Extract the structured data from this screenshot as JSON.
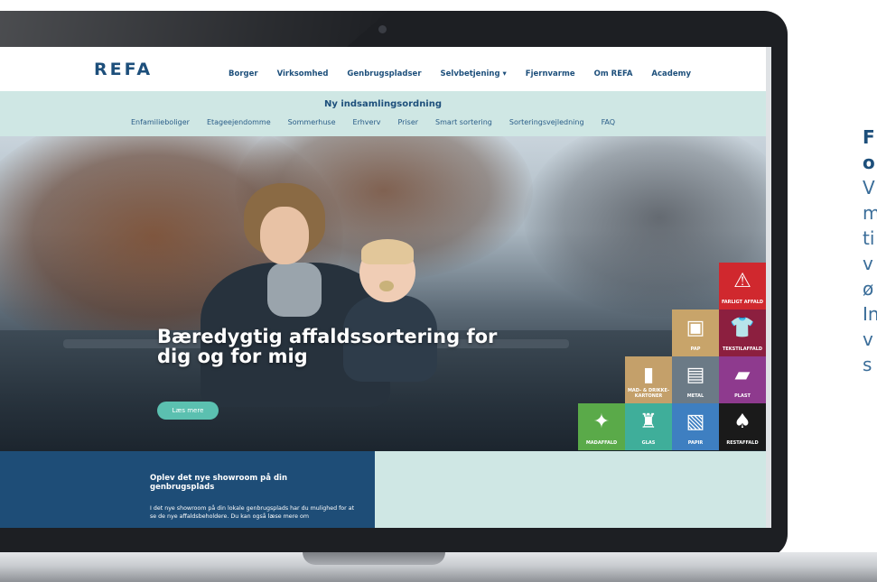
{
  "site": {
    "logo": "REFA",
    "main_menu": [
      "Borger",
      "Virksomhed",
      "Genbrugspladser",
      "Selvbetjening ▾",
      "Fjernvarme",
      "Om REFA",
      "Academy"
    ]
  },
  "subnav": {
    "title": "Ny indsamlingsordning",
    "items": [
      "Enfamilieboliger",
      "Etageejendomme",
      "Sommerhuse",
      "Erhverv",
      "Priser",
      "Smart sortering",
      "Sorteringsvejledning",
      "FAQ"
    ]
  },
  "hero": {
    "title": "Bæredygtig affaldssortering for dig og for mig",
    "button": "Læs mere"
  },
  "tiles": [
    {
      "label": "FARLIGT AFFALD",
      "icon": "⚠",
      "color": "#d0282e",
      "icon_name": "hazard-icon"
    },
    {
      "label": "PAP",
      "icon": "▣",
      "color": "#c8a46a",
      "icon_name": "box-icon"
    },
    {
      "label": "TEKSTILAFFALD",
      "icon": "👕",
      "color": "#8c1f3f",
      "icon_name": "shirt-icon"
    },
    {
      "label": "MAD- & DRIKKE-KARTONER",
      "icon": "▮",
      "color": "#c4a06a",
      "icon_name": "carton-icon"
    },
    {
      "label": "METAL",
      "icon": "▤",
      "color": "#6b7a86",
      "icon_name": "can-icon"
    },
    {
      "label": "PLAST",
      "icon": "▰",
      "color": "#8e3a8e",
      "icon_name": "plastic-bottle-icon"
    },
    {
      "label": "MADAFFALD",
      "icon": "✦",
      "color": "#5aaa49",
      "icon_name": "apple-core-icon"
    },
    {
      "label": "GLAS",
      "icon": "♜",
      "color": "#3fae9a",
      "icon_name": "glass-bottle-icon"
    },
    {
      "label": "PAPIR",
      "icon": "▧",
      "color": "#3e7fc1",
      "icon_name": "paper-icon"
    },
    {
      "label": "RESTAFFALD",
      "icon": "♠",
      "color": "#1a1a1a",
      "icon_name": "trash-bag-icon"
    }
  ],
  "promo": {
    "title": "Oplev det nye showroom på din genbrugsplads",
    "text": "I det nye showroom på din lokale genbrugsplads har du mulighed for at se de nye affaldsbeholdere. Du kan også læse mere om"
  },
  "side_text": {
    "heading": [
      "F",
      "o"
    ],
    "body": [
      "V",
      "m",
      "ti",
      "v",
      "ø",
      "In",
      "v",
      "s"
    ]
  }
}
